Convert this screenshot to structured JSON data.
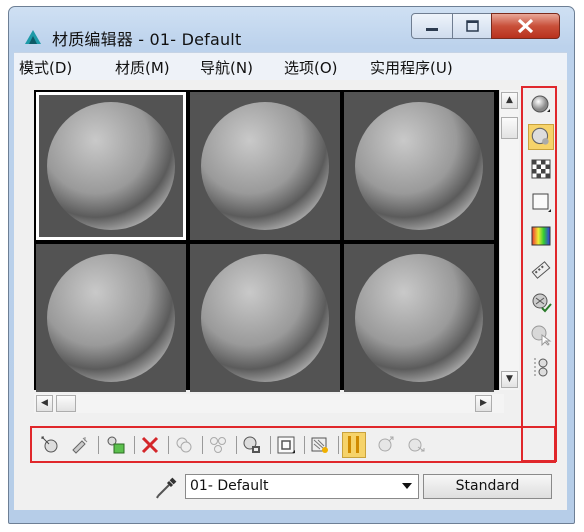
{
  "window": {
    "title": "材质编辑器 - 01- Default",
    "controls": {
      "minimize": "minimize",
      "maximize": "maximize",
      "close": "close"
    }
  },
  "menu": {
    "items": [
      "模式(D)",
      "材质(M)",
      "导航(N)",
      "选项(O)",
      "实用程序(U)"
    ]
  },
  "sample_slots": {
    "count": 6,
    "selected_index": 0
  },
  "side_toolbar": {
    "tools": [
      "sample-type-sphere-icon",
      "backlight-icon",
      "background-checker-icon",
      "sample-uv-tiling-icon",
      "video-color-check-icon",
      "make-preview-icon",
      "options-icon",
      "select-by-material-icon",
      "material-map-navigator-icon"
    ]
  },
  "bottom_toolbar": {
    "tools": [
      "get-material-icon",
      "put-material-to-scene-icon",
      "assign-material-icon",
      "reset-map-icon",
      "copy-material-icon",
      "make-unique-icon",
      "put-to-library-icon",
      "material-id-channel-icon",
      "show-shaded-material-icon",
      "show-end-result-icon",
      "go-to-parent-icon",
      "go-forward-to-sibling-icon"
    ]
  },
  "material": {
    "name": "01- Default",
    "type": "Standard"
  },
  "colors": {
    "highlight_border": "#e0272b",
    "slot_background": "#535353",
    "active_tool": "#f6d36a"
  }
}
